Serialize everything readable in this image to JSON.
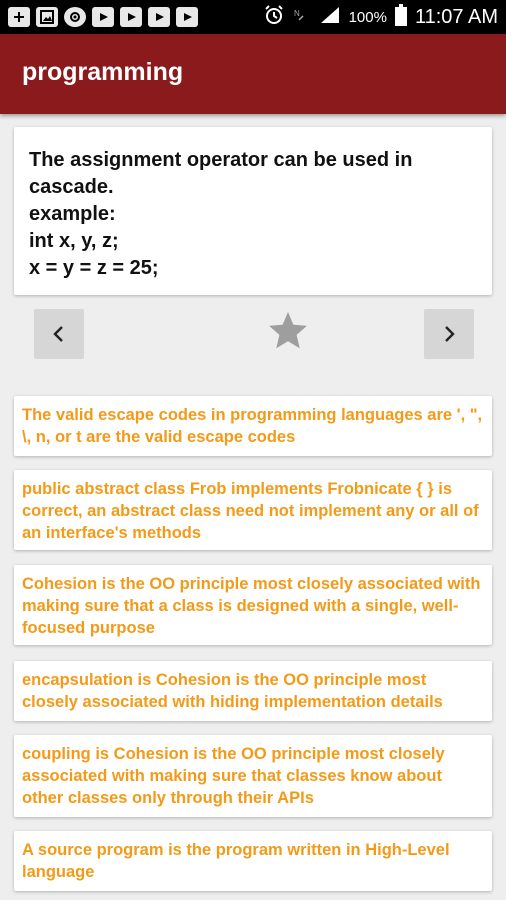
{
  "status_bar": {
    "battery_percent": "100%",
    "time": "11:07 AM",
    "left_icons": [
      "add-box-icon",
      "image-icon",
      "settings-badge-icon",
      "youtube-icon",
      "youtube-icon",
      "youtube-icon",
      "youtube-icon"
    ],
    "right_icons": [
      "alarm-icon",
      "nfc-icon",
      "signal-icon",
      "battery-icon"
    ]
  },
  "app_bar": {
    "title": "programming",
    "color": "#8b1a1d"
  },
  "question": {
    "lines": [
      "The assignment operator can be used in",
      "cascade.",
      "example:",
      "int x, y, z;",
      "x = y = z = 25;"
    ]
  },
  "navigation": {
    "prev_icon": "chevron-left-icon",
    "next_icon": "chevron-right-icon",
    "favorite_icon": "star-icon"
  },
  "related": {
    "text_color": "#f39a18",
    "items": [
      {
        "text": "The valid escape codes in programming languages are ', \", \\, n, or t are the valid escape codes"
      },
      {
        "text": "public abstract class Frob implements Frobnicate { } is correct, an abstract class need not implement any or all of an interface's methods"
      },
      {
        "text": "Cohesion is the OO principle most closely associated with making sure that a class is designed with a single, well-focused purpose"
      },
      {
        "text": "encapsulation is Cohesion is the OO principle most closely associated with hiding implementation details"
      },
      {
        "text": "coupling is Cohesion is the OO principle most closely associated with making sure that classes know about other classes only through their APIs"
      },
      {
        "text": "A source program is the program written in High-Level language"
      }
    ]
  }
}
